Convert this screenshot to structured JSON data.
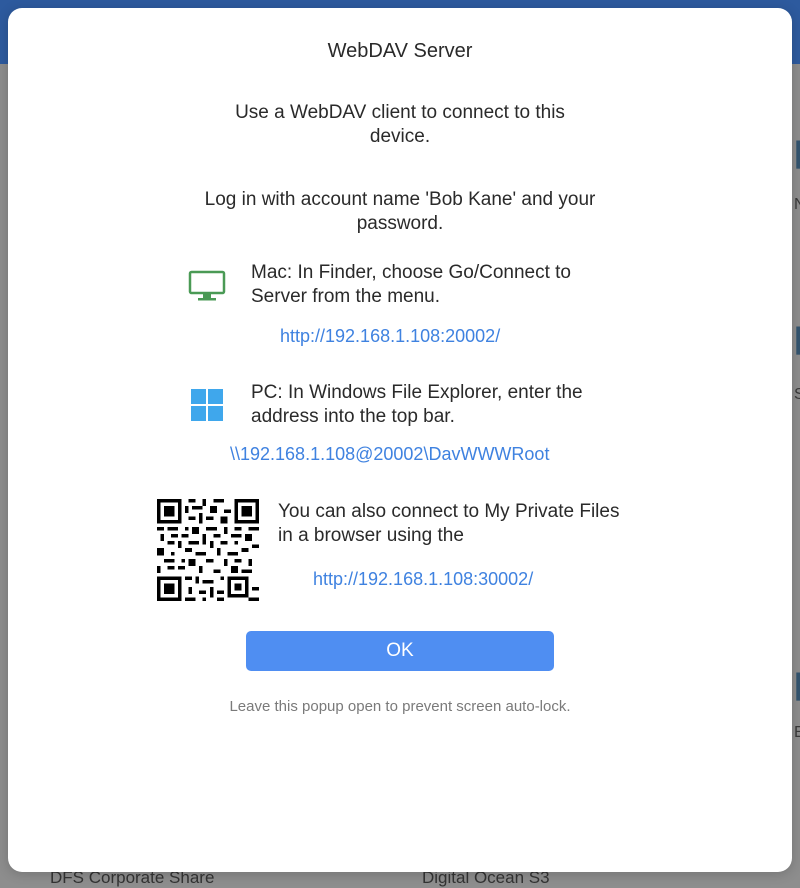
{
  "background": {
    "bottom_left_label": "DFS Corporate Share",
    "bottom_right_label": "Digital Ocean S3",
    "edge_letters": [
      "N",
      "S",
      "E"
    ]
  },
  "dialog": {
    "title": "WebDAV Server",
    "intro": "Use a WebDAV client to connect to this device.",
    "login_note": "Log in with account name 'Bob Kane' and your password.",
    "mac": {
      "icon": "monitor-icon",
      "icon_color": "#4a9a55",
      "instruction": "Mac: In Finder, choose Go/Connect to Server from the menu.",
      "url": "http://192.168.1.108:20002/"
    },
    "pc": {
      "icon": "windows-logo-icon",
      "icon_color": "#3fa7ec",
      "instruction": "PC: In Windows File Explorer, enter the address into the top bar.",
      "path": "\\\\192.168.1.108@20002\\DavWWWRoot"
    },
    "browser": {
      "icon": "qr-code-icon",
      "instruction": "You can also connect to My Private Files in a browser using the",
      "url": "http://192.168.1.108:30002/"
    },
    "ok_label": "OK",
    "footnote": "Leave this popup open to prevent screen auto-lock."
  },
  "colors": {
    "link": "#3f82e0",
    "button": "#4f8ef2"
  }
}
